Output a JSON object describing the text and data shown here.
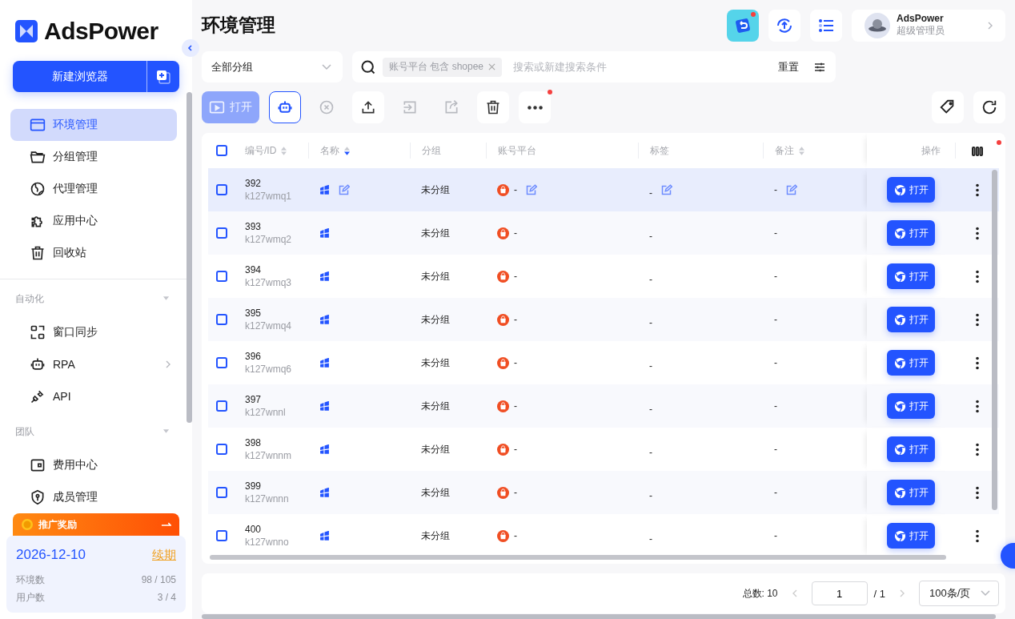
{
  "logo": {
    "text": "AdsPower"
  },
  "new_browser_button": {
    "label": "新建浏览器"
  },
  "nav": [
    {
      "label": "环境管理",
      "kind": "browser",
      "selected": true
    },
    {
      "label": "分组管理",
      "kind": "folder",
      "selected": false
    },
    {
      "label": "代理管理",
      "kind": "globe",
      "selected": false
    },
    {
      "label": "应用中心",
      "kind": "puzzle",
      "selected": false
    },
    {
      "label": "回收站",
      "kind": "trash",
      "selected": false
    }
  ],
  "sections": [
    {
      "title": "自动化",
      "expanded": true,
      "items": [
        {
          "label": "窗口同步",
          "kind": "sync",
          "submenu": false,
          "selected": false
        },
        {
          "label": "RPA",
          "kind": "robot",
          "submenu": true,
          "selected": false
        },
        {
          "label": "API",
          "kind": "plug",
          "submenu": false,
          "selected": false
        }
      ]
    },
    {
      "title": "团队",
      "expanded": true,
      "items": [
        {
          "label": "费用中心",
          "kind": "wallet",
          "submenu": false,
          "selected": false
        },
        {
          "label": "成员管理",
          "kind": "shield",
          "submenu": false,
          "selected": false
        }
      ]
    }
  ],
  "promo": {
    "label": "推广奖励"
  },
  "plan": {
    "expiry": "2026-12-10",
    "renew": "续期",
    "stats": [
      {
        "label": "环境数",
        "value": "98 / 105"
      },
      {
        "label": "用户数",
        "value": "3 / 4"
      }
    ]
  },
  "page_title": "环境管理",
  "header_actions": [
    {
      "kind": "app",
      "badge": true
    },
    {
      "kind": "upgrade",
      "badge": false
    },
    {
      "kind": "tasks",
      "badge": false
    }
  ],
  "user": {
    "name": "AdsPower",
    "role": "超级管理员"
  },
  "group_filter": {
    "value": "全部分组"
  },
  "search": {
    "chip": "账号平台 包含 shopee",
    "placeholder": "搜索或新建搜索条件",
    "reset": "重置"
  },
  "toolbar": [
    {
      "kind": "open",
      "label": "打开",
      "disabled": true
    },
    {
      "kind": "rpa",
      "disabled": false
    },
    {
      "kind": "stop",
      "disabled": true
    },
    {
      "kind": "upload",
      "disabled": false
    },
    {
      "kind": "import",
      "disabled": true
    },
    {
      "kind": "export",
      "disabled": true
    },
    {
      "kind": "delete",
      "disabled": false
    },
    {
      "kind": "more",
      "disabled": false,
      "badge": true
    }
  ],
  "right_tools": [
    {
      "kind": "tag"
    },
    {
      "kind": "refresh"
    }
  ],
  "table": {
    "all_checked": false,
    "columns": [
      {
        "label": "编号/ID",
        "sortable": true,
        "sorted_descending": false
      },
      {
        "label": "名称",
        "sortable": true,
        "sorted_descending": true
      },
      {
        "label": "分组",
        "sortable": false
      },
      {
        "label": "账号平台",
        "sortable": false
      },
      {
        "label": "标签",
        "sortable": false
      },
      {
        "label": "备注",
        "sortable": true,
        "sorted_descending": false
      }
    ],
    "action_column": "操作",
    "column_settings_badge": true,
    "rows": [
      {
        "serial": "392",
        "id": "k127wmq1",
        "group": "未分组",
        "platform": "-",
        "tag": "-",
        "note": "-",
        "checked": false,
        "highlighted": true,
        "action": "打开"
      },
      {
        "serial": "393",
        "id": "k127wmq2",
        "group": "未分组",
        "platform": "-",
        "tag": "-",
        "note": "-",
        "checked": false,
        "highlighted": false,
        "action": "打开"
      },
      {
        "serial": "394",
        "id": "k127wmq3",
        "group": "未分组",
        "platform": "-",
        "tag": "-",
        "note": "-",
        "checked": false,
        "highlighted": false,
        "action": "打开"
      },
      {
        "serial": "395",
        "id": "k127wmq4",
        "group": "未分组",
        "platform": "-",
        "tag": "-",
        "note": "-",
        "checked": false,
        "highlighted": false,
        "action": "打开"
      },
      {
        "serial": "396",
        "id": "k127wmq6",
        "group": "未分组",
        "platform": "-",
        "tag": "-",
        "note": "-",
        "checked": false,
        "highlighted": false,
        "action": "打开"
      },
      {
        "serial": "397",
        "id": "k127wnnl",
        "group": "未分组",
        "platform": "-",
        "tag": "-",
        "note": "-",
        "checked": false,
        "highlighted": false,
        "action": "打开"
      },
      {
        "serial": "398",
        "id": "k127wnnm",
        "group": "未分组",
        "platform": "-",
        "tag": "-",
        "note": "-",
        "checked": false,
        "highlighted": false,
        "action": "打开"
      },
      {
        "serial": "399",
        "id": "k127wnnn",
        "group": "未分组",
        "platform": "-",
        "tag": "-",
        "note": "-",
        "checked": false,
        "highlighted": false,
        "action": "打开"
      },
      {
        "serial": "400",
        "id": "k127wnno",
        "group": "未分组",
        "platform": "-",
        "tag": "-",
        "note": "-",
        "checked": false,
        "highlighted": false,
        "action": "打开"
      }
    ]
  },
  "footer": {
    "total": "总数: 10",
    "page": "1",
    "pages": "/ 1",
    "page_size": "100条/页"
  }
}
